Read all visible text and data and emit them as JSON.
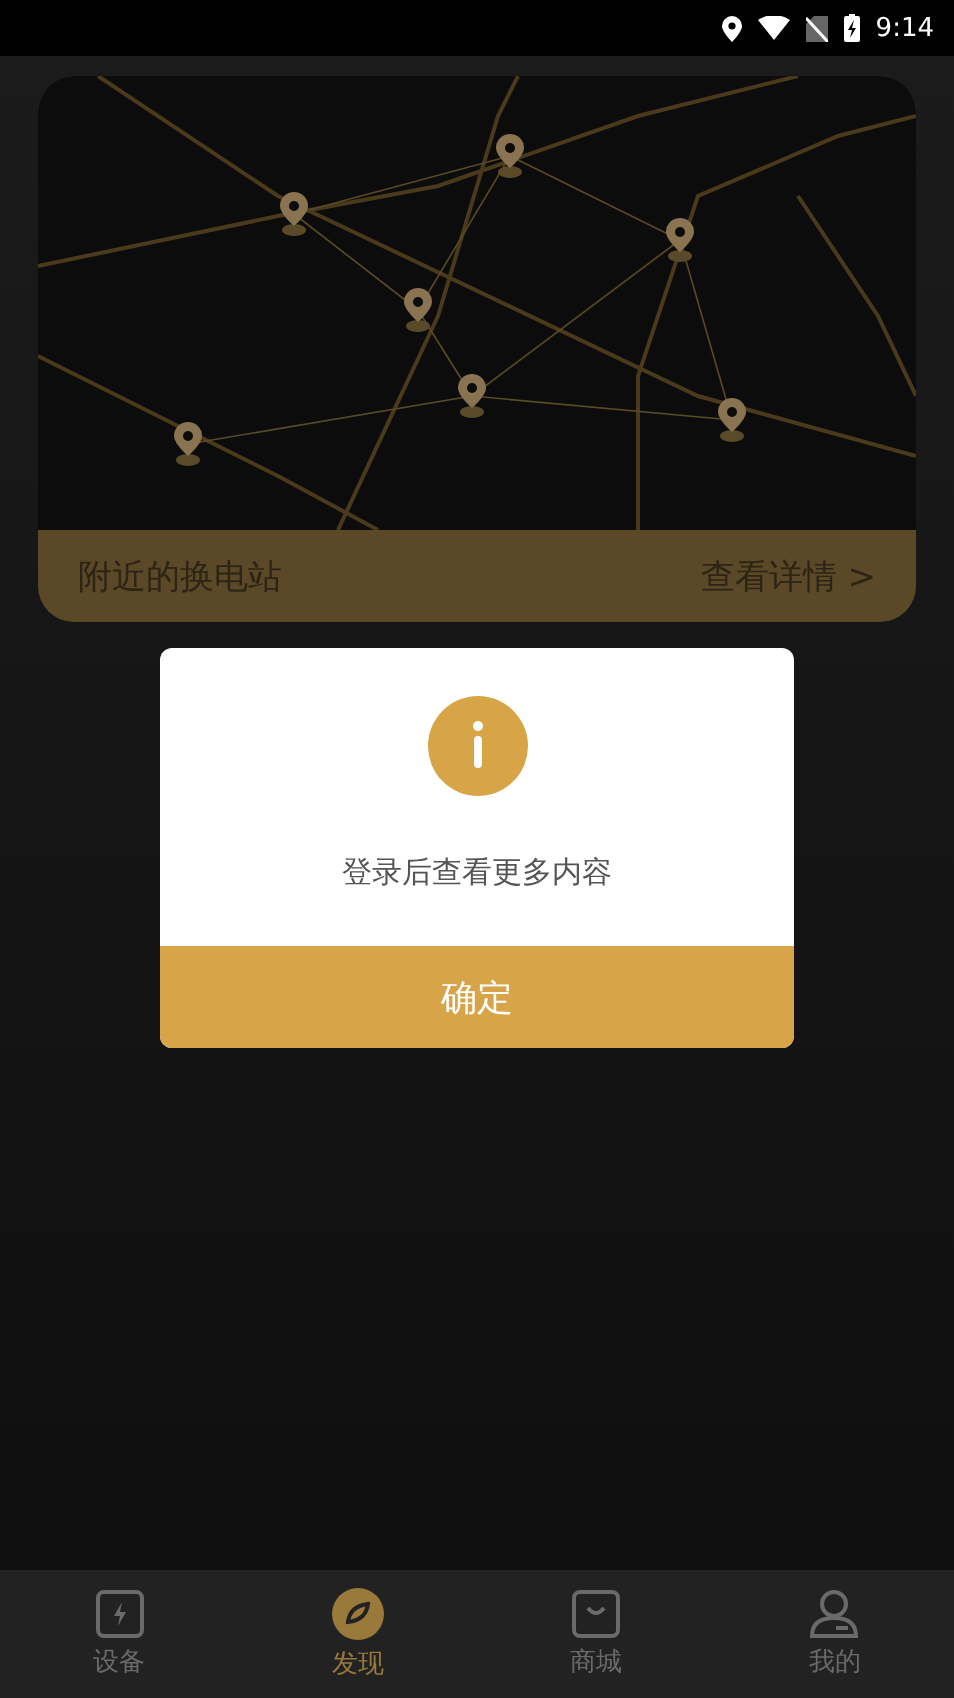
{
  "status_bar": {
    "time": "9:14"
  },
  "station_card": {
    "title": "附近的换电站",
    "link": "查看详情",
    "chevron": ">"
  },
  "dialog": {
    "message": "登录后查看更多内容",
    "button": "确定"
  },
  "tabs": [
    {
      "label": "设备",
      "kind": "device",
      "selected": false
    },
    {
      "label": "发现",
      "kind": "discover",
      "selected": true
    },
    {
      "label": "商城",
      "kind": "shop",
      "selected": false
    },
    {
      "label": "我的",
      "kind": "profile",
      "selected": false
    }
  ]
}
